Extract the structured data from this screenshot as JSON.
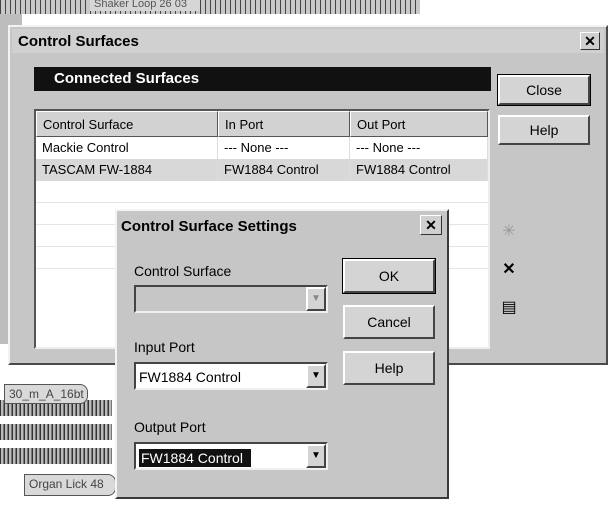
{
  "background": {
    "clip_top": "Shaker Loop 26 03",
    "clip_middle": "30_m_A_16bt",
    "clip_bottom": "Organ Lick 48"
  },
  "main_dialog": {
    "title": "Control Surfaces",
    "close_glyph": "✕",
    "section_title": "Connected Surfaces",
    "buttons": {
      "close": "Close",
      "help": "Help"
    },
    "columns": [
      "Control Surface",
      "In Port",
      "Out Port"
    ],
    "rows": [
      {
        "surface": "Mackie Control",
        "in_port": "--- None ---",
        "out_port": "--- None ---"
      },
      {
        "surface": "TASCAM FW-1884",
        "in_port": "FW1884 Control",
        "out_port": "FW1884 Control"
      }
    ],
    "tools": {
      "add": "✳",
      "delete": "✕",
      "properties": "▤"
    }
  },
  "settings_dialog": {
    "title": "Control Surface Settings",
    "close_glyph": "✕",
    "control_surface_label": "Control Surface",
    "control_surface_value": "",
    "input_port_label": "Input Port",
    "input_port_value": "FW1884 Control",
    "output_port_label": "Output Port",
    "output_port_value": "FW1884 Control",
    "combo_arrow": "▼",
    "buttons": {
      "ok": "OK",
      "cancel": "Cancel",
      "help": "Help"
    }
  }
}
